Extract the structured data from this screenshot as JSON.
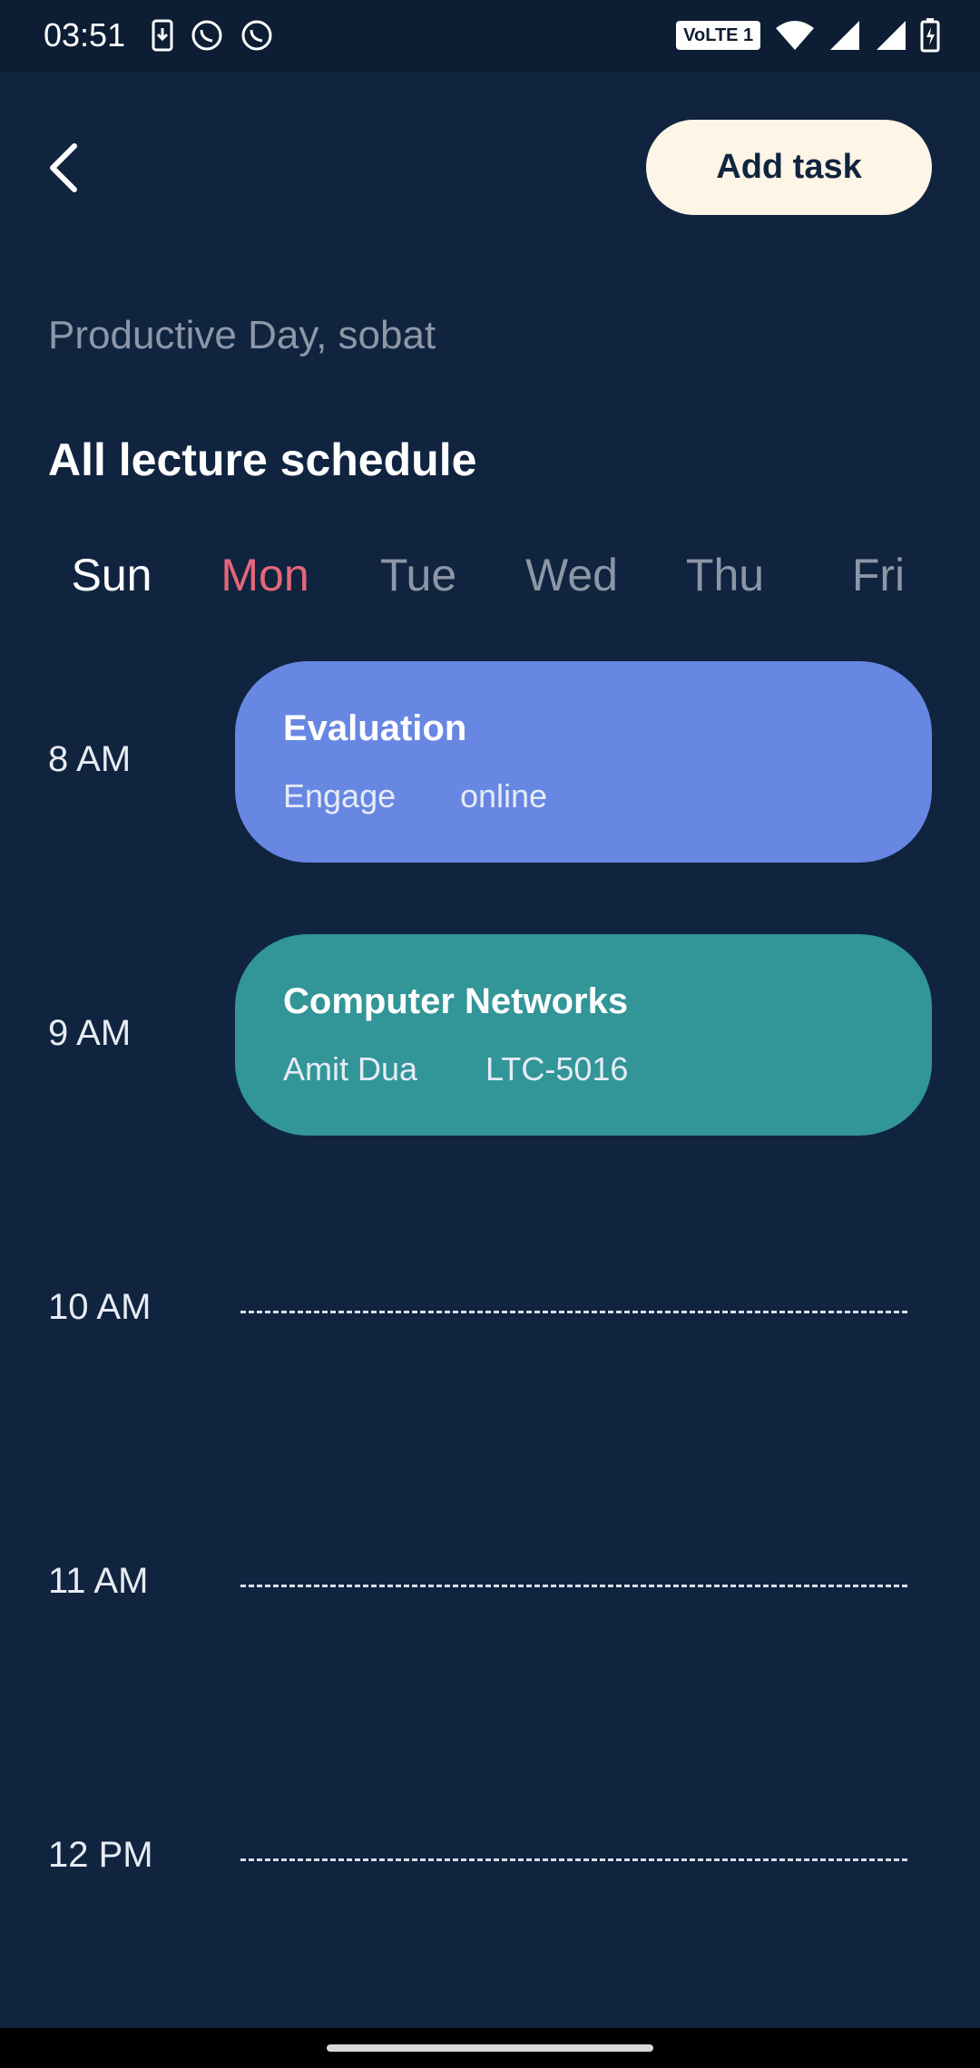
{
  "status_bar": {
    "time": "03:51",
    "volte": "VoLTE 1",
    "icons_left": [
      "download-icon",
      "whatsapp-icon",
      "whatsapp-icon"
    ],
    "icons_right": [
      "wifi-icon",
      "signal-icon",
      "signal-roaming-icon",
      "battery-charging-icon"
    ]
  },
  "header": {
    "back_icon": "chevron-left-icon",
    "add_task_label": "Add task"
  },
  "greeting": "Productive Day, sobat",
  "section_title": "All lecture schedule",
  "days": [
    "Sun",
    "Mon",
    "Tue",
    "Wed",
    "Thu",
    "Fri"
  ],
  "selected_day": "Mon",
  "time_slots": [
    "8 AM",
    "9 AM",
    "10 AM",
    "11 AM",
    "12 PM"
  ],
  "lectures": [
    {
      "title": "Evaluation",
      "instructor": "Engage",
      "location": "online",
      "color": "#6887e3"
    },
    {
      "title": "Computer Networks",
      "instructor": "Amit Dua",
      "location": "LTC-5016",
      "color": "#329598"
    }
  ],
  "colors": {
    "background": "#102440",
    "accent_day": "#e5677a",
    "button_bg": "#fdf5e5"
  }
}
